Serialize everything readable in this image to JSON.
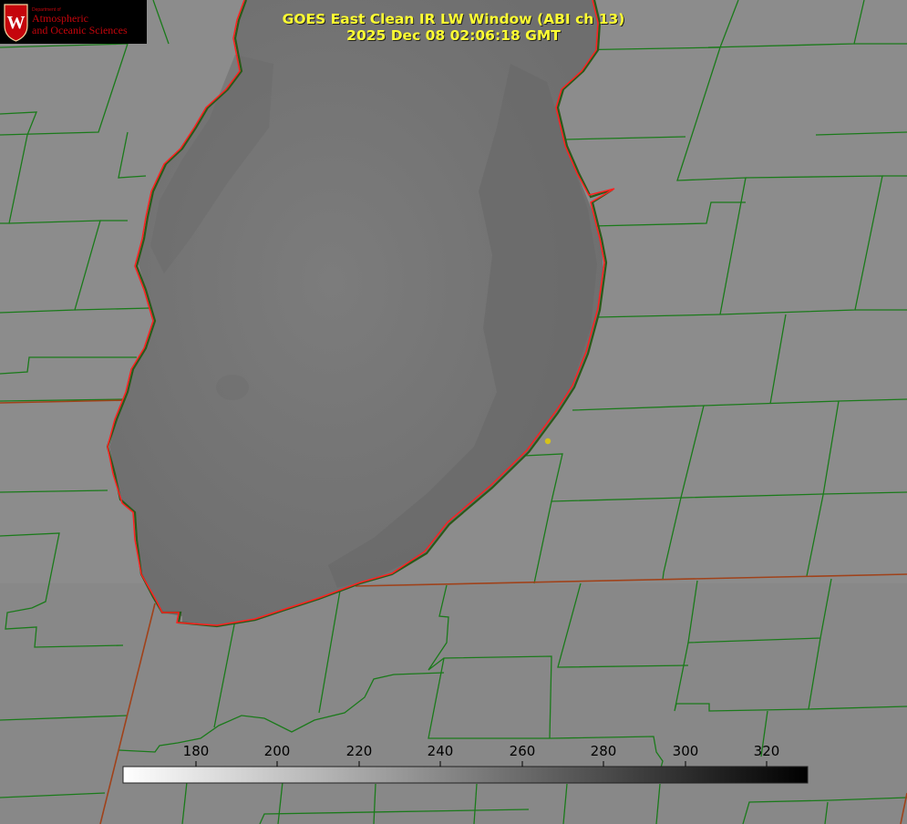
{
  "title_line1": "GOES East Clean IR LW Window (ABI ch 13)",
  "title_line2": "2025 Dec 08 02:06:18 GMT",
  "logo": {
    "dept": "Department of",
    "line1": "Atmospheric",
    "line2": "and Oceanic Sciences",
    "seal_letter": "W"
  },
  "colorbar": {
    "ticks": [
      "180",
      "200",
      "220",
      "240",
      "260",
      "280",
      "300",
      "320"
    ],
    "min": 163,
    "max": 330,
    "gradient": "white-to-black"
  },
  "colors": {
    "county_lines": "#1a7a1a",
    "state_lines": "#c0400a",
    "lake_outline": "#ff2020",
    "title": "#ffff33",
    "marker": "#d6c21a"
  },
  "icons": [
    "uw-seal-icon",
    "location-dot-icon"
  ]
}
